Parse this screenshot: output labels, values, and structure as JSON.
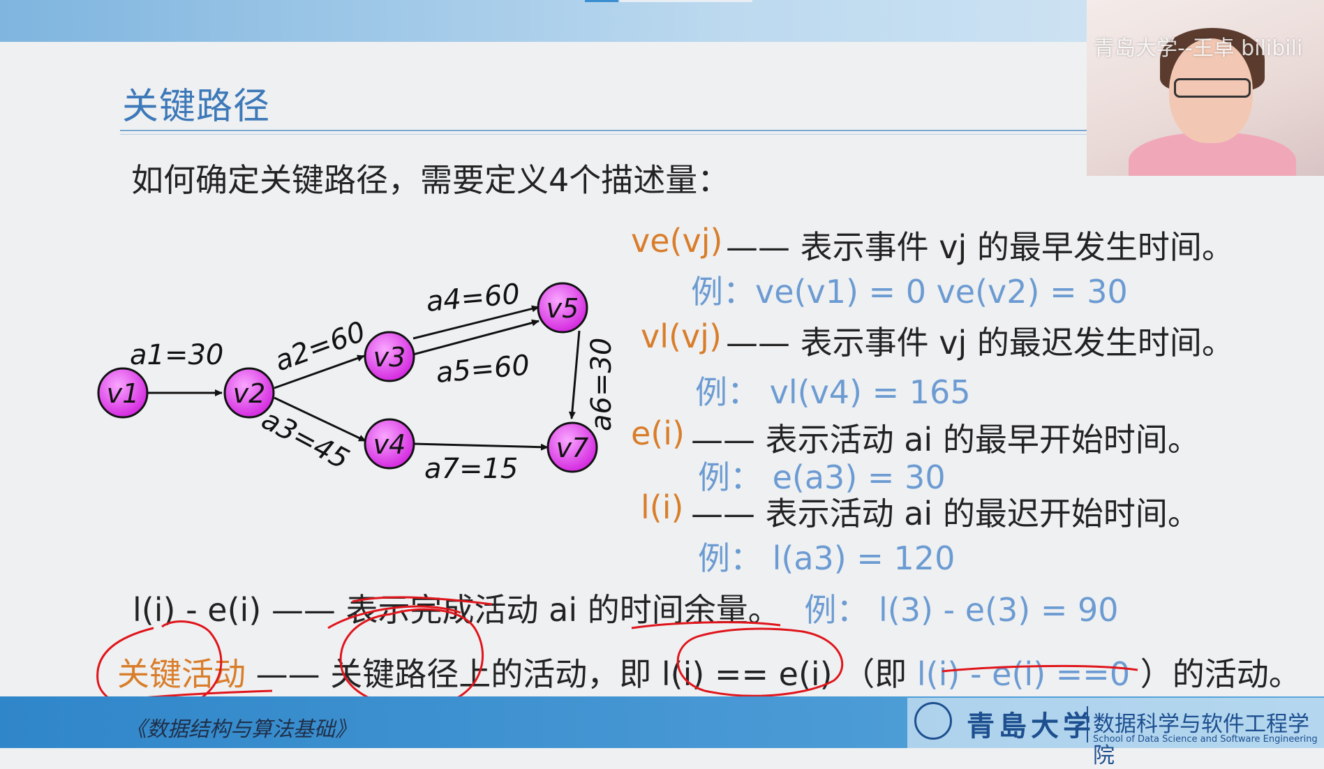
{
  "header": {
    "title": "关键路径",
    "intro": "如何确定关键路径，需要定义4个描述量："
  },
  "graph": {
    "nodes": [
      "v1",
      "v2",
      "v3",
      "v4",
      "v5",
      "v7"
    ],
    "edges": {
      "a1": "a1=30",
      "a2": "a2=60",
      "a3": "a3=45",
      "a4": "a4=60",
      "a5": "a5=60",
      "a6": "a6=30",
      "a7": "a7=15"
    },
    "node_color": "#e24be8"
  },
  "definitions": [
    {
      "term": "ve(vj)",
      "desc": "—— 表示事件 vj 的最早发生时间。",
      "example": "例：ve(v1) = 0     ve(v2) = 30"
    },
    {
      "term": "vl(vj)",
      "desc": "—— 表示事件 vj 的最迟发生时间。",
      "example": "例：  vl(v4) = 165"
    },
    {
      "term": "e(i)",
      "desc": "—— 表示活动 ai 的最早开始时间。",
      "example": "例：  e(a3) = 30"
    },
    {
      "term": "l(i)",
      "desc": "—— 表示活动 ai 的最迟开始时间。",
      "example": "例：  l(a3) = 120"
    }
  ],
  "slack": {
    "term": "l(i) - e(i)",
    "desc": "—— 表示完成活动 ai 的时间余量。",
    "example": "例：  l(3) - e(3) = 90"
  },
  "critical": {
    "term": "关键活动",
    "desc": "—— 关键路径上的活动，即 l(i) == e(i) （即 ",
    "highlight": "l(i) - e(i) ==0",
    "tail": " ）的活动。"
  },
  "footer": {
    "course": "《数据结构与算法基础》",
    "university": "青島大学",
    "school_cn": "数据科学与软件工程学院",
    "school_en": "School of Data Science and Software Engineering"
  },
  "watermark": "青岛大学--王卓 bilibili",
  "colors": {
    "accent_orange": "#d97d2a",
    "example_blue": "#6c9bd2",
    "title_blue": "#3d78b8",
    "annotation_red": "#e0151b"
  }
}
